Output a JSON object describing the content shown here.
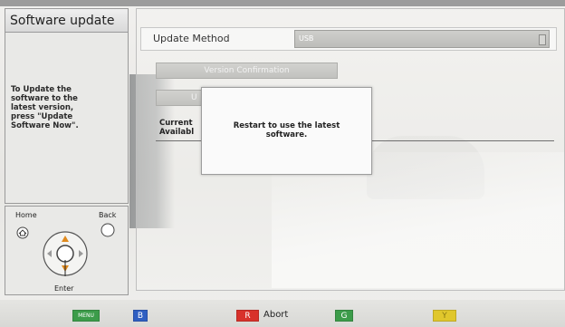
{
  "left": {
    "title": "Software update",
    "description_lines": [
      "To Update the",
      "software to the",
      "latest version,",
      "press \"Update",
      "Software Now\"."
    ],
    "remote": {
      "home_label": "Home",
      "back_label": "Back",
      "enter_label": "Enter"
    }
  },
  "main": {
    "update_method": {
      "label": "Update Method",
      "value": "USB"
    },
    "version_confirmation_button": "Version Confirmation",
    "update_button_visible_text": "U",
    "info_lines": [
      "Current",
      "Availabl"
    ]
  },
  "dialog": {
    "lines": [
      "Restart to use the latest",
      "software."
    ]
  },
  "bottom_keys": [
    {
      "key": "MENU",
      "color": "#3c9c4a",
      "label": ""
    },
    {
      "key": "B",
      "color": "#2f5fc2",
      "label": ""
    },
    {
      "key": "R",
      "color": "#d8322b",
      "label": "Abort"
    },
    {
      "key": "G",
      "color": "#3c9c4a",
      "label": ""
    },
    {
      "key": "Y",
      "color": "#e0c72c",
      "label": ""
    }
  ]
}
